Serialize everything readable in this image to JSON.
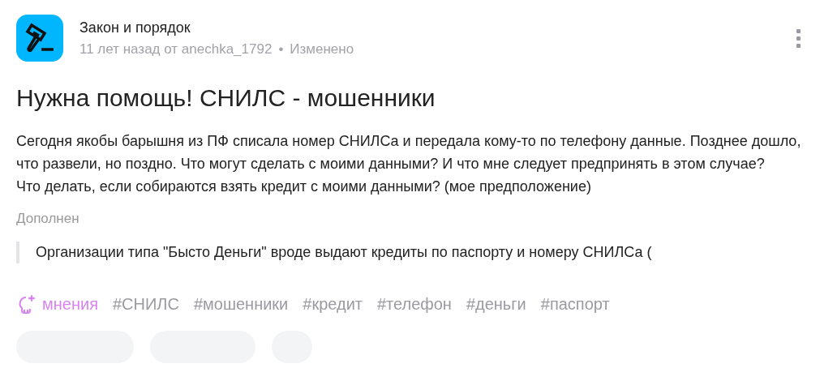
{
  "community": {
    "name": "Закон и порядок",
    "meta": "11 лет назад от anechka_1792",
    "separator": "•",
    "edited": "Изменено"
  },
  "question": {
    "title": "Нужна помощь! СНИЛС - мошенники",
    "body": [
      "Сегодня якобы барышня из ПФ списала номер СНИЛСа и передала кому-то по телефону данные. Позднее дошло, что развели, но поздно. Что могут сделать с моими данными? И что мне следует предпринять в этом случае?",
      "Что делать, если собираются взять кредит с моими данными? (мое предположение)"
    ],
    "addendum_label": "Дополнен",
    "addendum": "Организации типа \"Бысто Деньги\" вроде выдают кредиты по паспорту и номеру СНИЛСа ("
  },
  "opinions": "мнения",
  "tags": [
    "#СНИЛС",
    "#мошенники",
    "#кредит",
    "#телефон",
    "#деньги",
    "#паспорт"
  ],
  "action_buttons": [
    {
      "kind": "pill"
    },
    {
      "kind": "pill"
    },
    {
      "kind": "pill"
    }
  ]
}
